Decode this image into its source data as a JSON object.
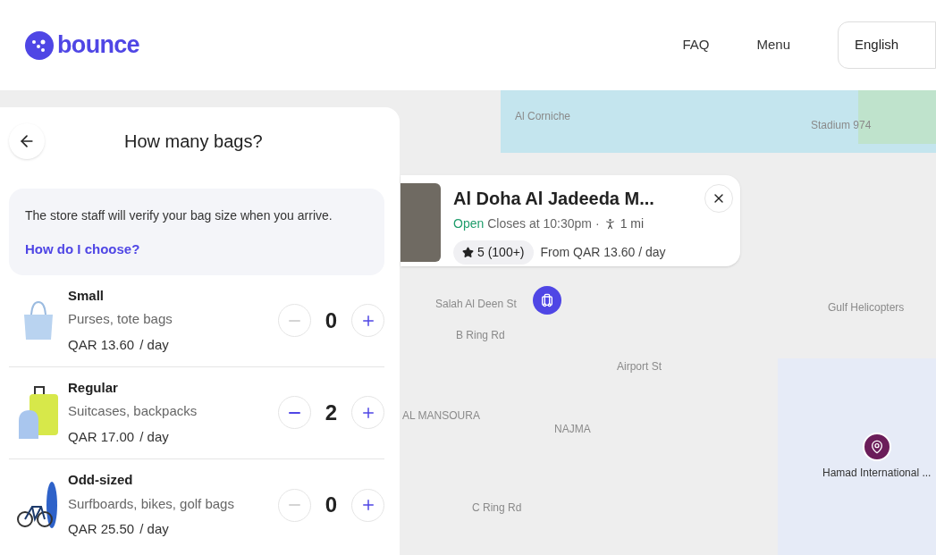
{
  "header": {
    "logo": "bounce",
    "nav": [
      "FAQ",
      "Menu"
    ],
    "language": "English"
  },
  "panel": {
    "title": "How many bags?",
    "notice": {
      "text": "The store staff will verify your bag size when you arrive.",
      "link": "How do I choose?"
    },
    "bags": [
      {
        "kind": "tote",
        "name": "Small",
        "description": "Purses, tote bags",
        "price": "QAR 13.60",
        "unit": "/ day",
        "count": "0",
        "can_decrease": false
      },
      {
        "kind": "suitcase",
        "name": "Regular",
        "description": "Suitcases, backpacks",
        "price": "QAR 17.00",
        "unit": "/ day",
        "count": "2",
        "can_decrease": true
      },
      {
        "kind": "bike",
        "name": "Odd-sized",
        "description": "Surfboards, bikes, golf bags",
        "price": "QAR 25.50",
        "unit": "/ day",
        "count": "0",
        "can_decrease": false
      }
    ]
  },
  "map": {
    "labels": [
      {
        "text": "Al Corniche"
      },
      {
        "text": "Stadium 974"
      },
      {
        "text": "Salah Al Deen St"
      },
      {
        "text": "B Ring Rd"
      },
      {
        "text": "AL MANSOURA"
      },
      {
        "text": "NAJMA"
      },
      {
        "text": "Airport St"
      },
      {
        "text": "C Ring Rd"
      },
      {
        "text": "Gulf Helicopters"
      }
    ],
    "poi": {
      "name": "Hamad International ..."
    },
    "store": {
      "name": "Al Doha Al Jadeeda M...",
      "status": "Open",
      "hours": "Closes at 10:30pm",
      "separator": "·",
      "distance": "1 mi",
      "rating": "5 (100+)",
      "price": "From QAR 13.60 / day"
    }
  }
}
